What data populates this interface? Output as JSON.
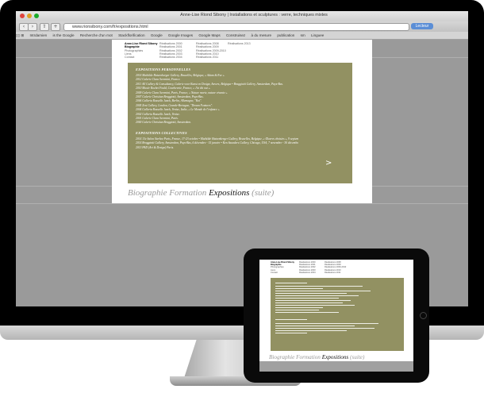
{
  "browser": {
    "window_title": "Anne-Lise Riond Sibony | Installations et sculptures : verre, techniques mixtes",
    "url": "www.rionsibony.com/fr/expositions.html",
    "reader_button": "Lecteur",
    "bookmarks": [
      "Intrdamien",
      "is the Google",
      "Recherche d'un mot",
      "Stackflorification",
      "Google",
      "Google Images",
      "Google Maps",
      "Construisez",
      "à du mesure",
      "publication",
      "sm",
      "Linguee"
    ]
  },
  "site": {
    "nav": {
      "col1": [
        "Anne-Lise Riond Sibony",
        "Biographie",
        "Photographies",
        "Liens",
        "Contact"
      ],
      "col2": [
        "Réalisations 2000",
        "Réalisations 2001",
        "Réalisations 2002",
        "Réalisations 2003",
        "Réalisations 2004"
      ],
      "col3": [
        "Réalisations 2008",
        "Réalisations 2009",
        "Réalisations 2009-2010",
        "Réalisations 2010",
        "Réalisations 2011"
      ],
      "col4": [
        "Réalisations 2013"
      ]
    },
    "section1_title": "EXPOSITIONS PERSONNELLES",
    "section1_items": [
      "2014 Mathilde Hatzenberger Gallery, Bruxelles, Belgique, « Adam & Eve ».",
      "2012 Galerie Clara Scremini, France.",
      "2011 All Gallery & Consultancy, Galerie voor Kunst en Design, Anvers, Belgique • Braggiotti Gallery, Amsterdam, Pays-Bas.",
      "2010 Musée Rochet Fould, Courbevoie, France, « J'ai dit oui ».",
      "2009 Galerie Clara Scremini, Paris, France, « Nature morte, nature vivante ».",
      "2007 Galerie Christian Braggiotti, Amsterdam, Pays-Bas.",
      "2006 Galleria Rossella Junck, Berlin, Allemagne, \"Roi\".",
      "2005 Zest Gallery, London, Grande-Bretagne, \"Dream Features\".",
      "2004 Galleria Rossella Junck, Venise, Italie, « Le Monde de l'enfance ».",
      "2002 Galleria Rossella Junck, Venise.",
      "2001 Galerie Clara Scremini, Paris.",
      "2000 Galerie Christian Braggiotti, Amsterdam."
    ],
    "section2_title": "EXPOSITIONS COLLECTIVES",
    "section2_items": [
      "2014 13e Salon Sterbez Paris, France, 17-23 octobre • Mathilde Hatzenberger Gallery, Bruxelles, Belgique, « Œuvres choisies », 9 septembre - 28 octobre.",
      "2014 Braggiotti Gallery, Amsterdam, Pays-Bas, 6 décembre - 15 janvier • Ken Saunders Gallery, Chicago, USA, 7 novembre - 30 décembre • Loch China Museum, French Art Tour \"The Wonderland of Glass\", 20 novembre - 31 décembre.",
      "2013 PAD (Art & Design) Paris."
    ],
    "arrow": ">",
    "caption": {
      "part1": "Biographie Formation ",
      "part2": "Expositions",
      "part3": " (suite)"
    }
  },
  "colors": {
    "panel": "#929162",
    "screen_bg": "#9a9a9a",
    "accent_button": "#5b8ed6"
  }
}
